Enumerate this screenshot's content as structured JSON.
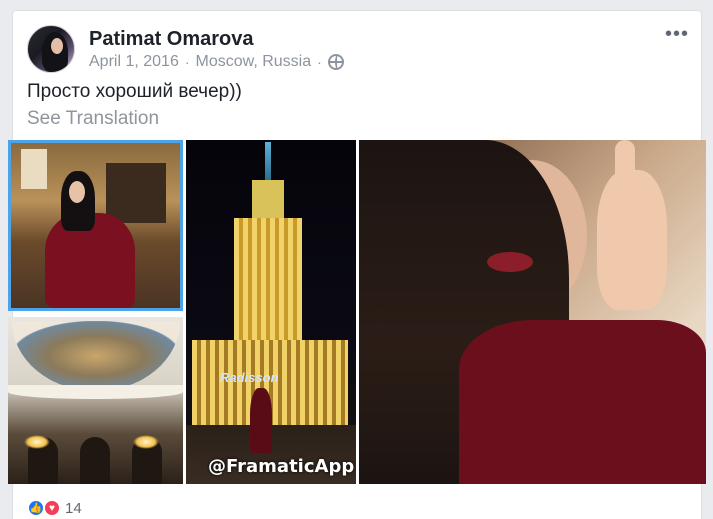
{
  "post": {
    "author": "Patimat Omarova",
    "date": "April 1, 2016",
    "location": "Moscow, Russia",
    "separator": "·",
    "privacy_icon": "globe-icon",
    "more_icon": "more-options-icon",
    "more_glyph": "•••",
    "text": "Просто хороший вечер))",
    "see_translation": "See Translation"
  },
  "photos": {
    "watermark": "@FramaticApp",
    "building_sign": "Radisson"
  },
  "reactions": {
    "like_glyph": "👍",
    "love_glyph": "♥",
    "count": "14"
  },
  "colors": {
    "selected_photo_border": "#4da3e6",
    "like": "#1877f2",
    "love": "#f33e58"
  }
}
